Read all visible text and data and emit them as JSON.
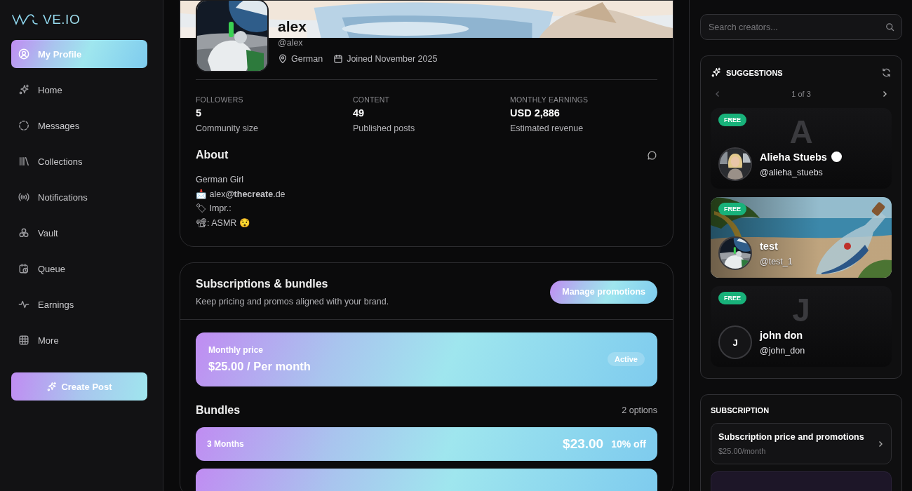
{
  "logo": {
    "text": "VE.IO"
  },
  "sidebar": {
    "items": [
      {
        "label": "My Profile",
        "selected": true
      },
      {
        "label": "Home",
        "selected": false
      },
      {
        "label": "Messages",
        "selected": false
      },
      {
        "label": "Collections",
        "selected": false
      },
      {
        "label": "Notifications",
        "selected": false
      },
      {
        "label": "Vault",
        "selected": false
      },
      {
        "label": "Queue",
        "selected": false
      },
      {
        "label": "Earnings",
        "selected": false
      },
      {
        "label": "More",
        "selected": false
      }
    ],
    "create_button": "Create Post"
  },
  "profile": {
    "name": "alex",
    "handle": "@alex",
    "location": "German",
    "joined": "Joined November 2025",
    "stats": [
      {
        "label": "FOLLOWERS",
        "value": "5",
        "caption": "Community size"
      },
      {
        "label": "CONTENT",
        "value": "49",
        "caption": "Published posts"
      },
      {
        "label": "MONTHLY EARNINGS",
        "value": "USD 2,886",
        "caption": "Estimated revenue"
      }
    ],
    "about": {
      "title": "About",
      "lines": [
        "German Girl",
        "📩 alex**@thecreate**.de",
        "🏷 Impr.:",
        "📽: ASMR 😯"
      ]
    }
  },
  "subscriptions": {
    "title": "Subscriptions & bundles",
    "subtitle": "Keep pricing and promos aligned with your brand.",
    "button": "Manage promotions",
    "monthly": {
      "label": "Monthly price",
      "price": "$25.00 / Per month",
      "status": "Active"
    },
    "bundles_title": "Bundles",
    "bundles_count": "2 options",
    "bundles": [
      {
        "label": "3 Months",
        "price": "$23.00",
        "discount": "10% off"
      }
    ]
  },
  "search": {
    "placeholder": "Search creators..."
  },
  "suggestions": {
    "title": "SUGGESTIONS",
    "pager": "1 of 3",
    "creators": [
      {
        "kind": "initial",
        "badge": "FREE",
        "initial": "A",
        "name": "Alieha Stuebs",
        "handle": "@alieha_stuebs",
        "verified": true
      },
      {
        "kind": "picture",
        "badge": "FREE",
        "name": "test",
        "handle": "@test_1",
        "verified": false
      },
      {
        "kind": "initial",
        "badge": "FREE",
        "initial": "J",
        "avatar": {
          "kind": "letter",
          "text": "J"
        },
        "name": "john don",
        "handle": "@john_don",
        "verified": false
      }
    ]
  },
  "subscription": {
    "title": "SUBSCRIPTION",
    "item": {
      "title": "Subscription price and promotions",
      "subtitle": "$25.00/month"
    }
  }
}
